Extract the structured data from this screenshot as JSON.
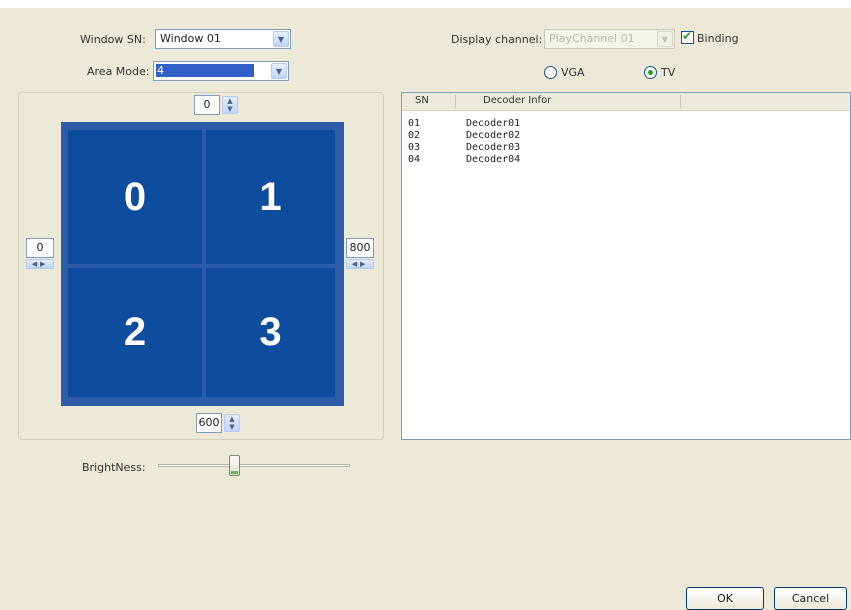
{
  "window_sn": {
    "label": "Window SN:",
    "value": "Window 01"
  },
  "area_mode": {
    "label": "Area Mode:",
    "value": "4"
  },
  "display_channel": {
    "label": "Display channel:",
    "value": "PlayChannel 01"
  },
  "binding": {
    "label": "Binding",
    "checked": true
  },
  "output": {
    "vga": {
      "label": "VGA",
      "selected": false
    },
    "tv": {
      "label": "TV",
      "selected": true
    }
  },
  "position": {
    "top": "0",
    "bottom": "600",
    "left": "0",
    "right": "800"
  },
  "grid_cells": [
    "0",
    "1",
    "2",
    "3"
  ],
  "decoder_list": {
    "columns": [
      "SN",
      "Decoder Infor"
    ],
    "rows": [
      {
        "sn": "01",
        "info": "Decoder01"
      },
      {
        "sn": "02",
        "info": "Decoder02"
      },
      {
        "sn": "03",
        "info": "Decoder03"
      },
      {
        "sn": "04",
        "info": "Decoder04"
      }
    ]
  },
  "brightness": {
    "label": "BrightNess:",
    "level": 0.4
  },
  "buttons": {
    "ok": "OK",
    "cancel": "Cancel"
  },
  "icons": {
    "combo_arrow": "chevron-down-icon",
    "spin_vertical": "up-down-arrows-icon",
    "spin_horizontal": "left-right-arrows-icon",
    "check": "checkmark-icon"
  },
  "colors": {
    "grid_cell": "#0e4d9d",
    "grid_frame": "#2d5ca8",
    "dialog_bg": "#ece9d8"
  }
}
